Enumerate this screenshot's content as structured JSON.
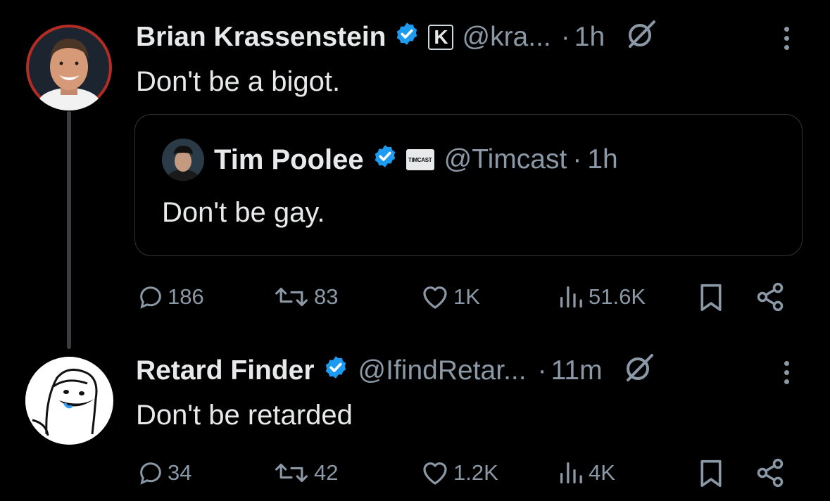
{
  "tweets": [
    {
      "name": "Brian Krassenstein",
      "badge": "K",
      "handle": "@kra...",
      "separator": "·",
      "time": "1h",
      "text": "Don't be a bigot.",
      "quote": {
        "name": "Tim Poolee",
        "badge": "TIMCAST",
        "handle": "@Timcast",
        "separator": "·",
        "time": "1h",
        "text": "Don't be gay."
      },
      "actions": {
        "replies": "186",
        "reposts": "83",
        "likes": "1K",
        "views": "51.6K"
      }
    },
    {
      "name": "Retard Finder",
      "handle": "@IfindRetar...",
      "separator": "·",
      "time": "11m",
      "text": "Don't be retarded",
      "actions": {
        "replies": "34",
        "reposts": "42",
        "likes": "1.2K",
        "views": "4K"
      }
    }
  ],
  "colors": {
    "background": "#000000",
    "text": "#e7e9ea",
    "secondary": "#8b98a5",
    "verified": "#1d9bf0",
    "border": "#2f3336"
  }
}
